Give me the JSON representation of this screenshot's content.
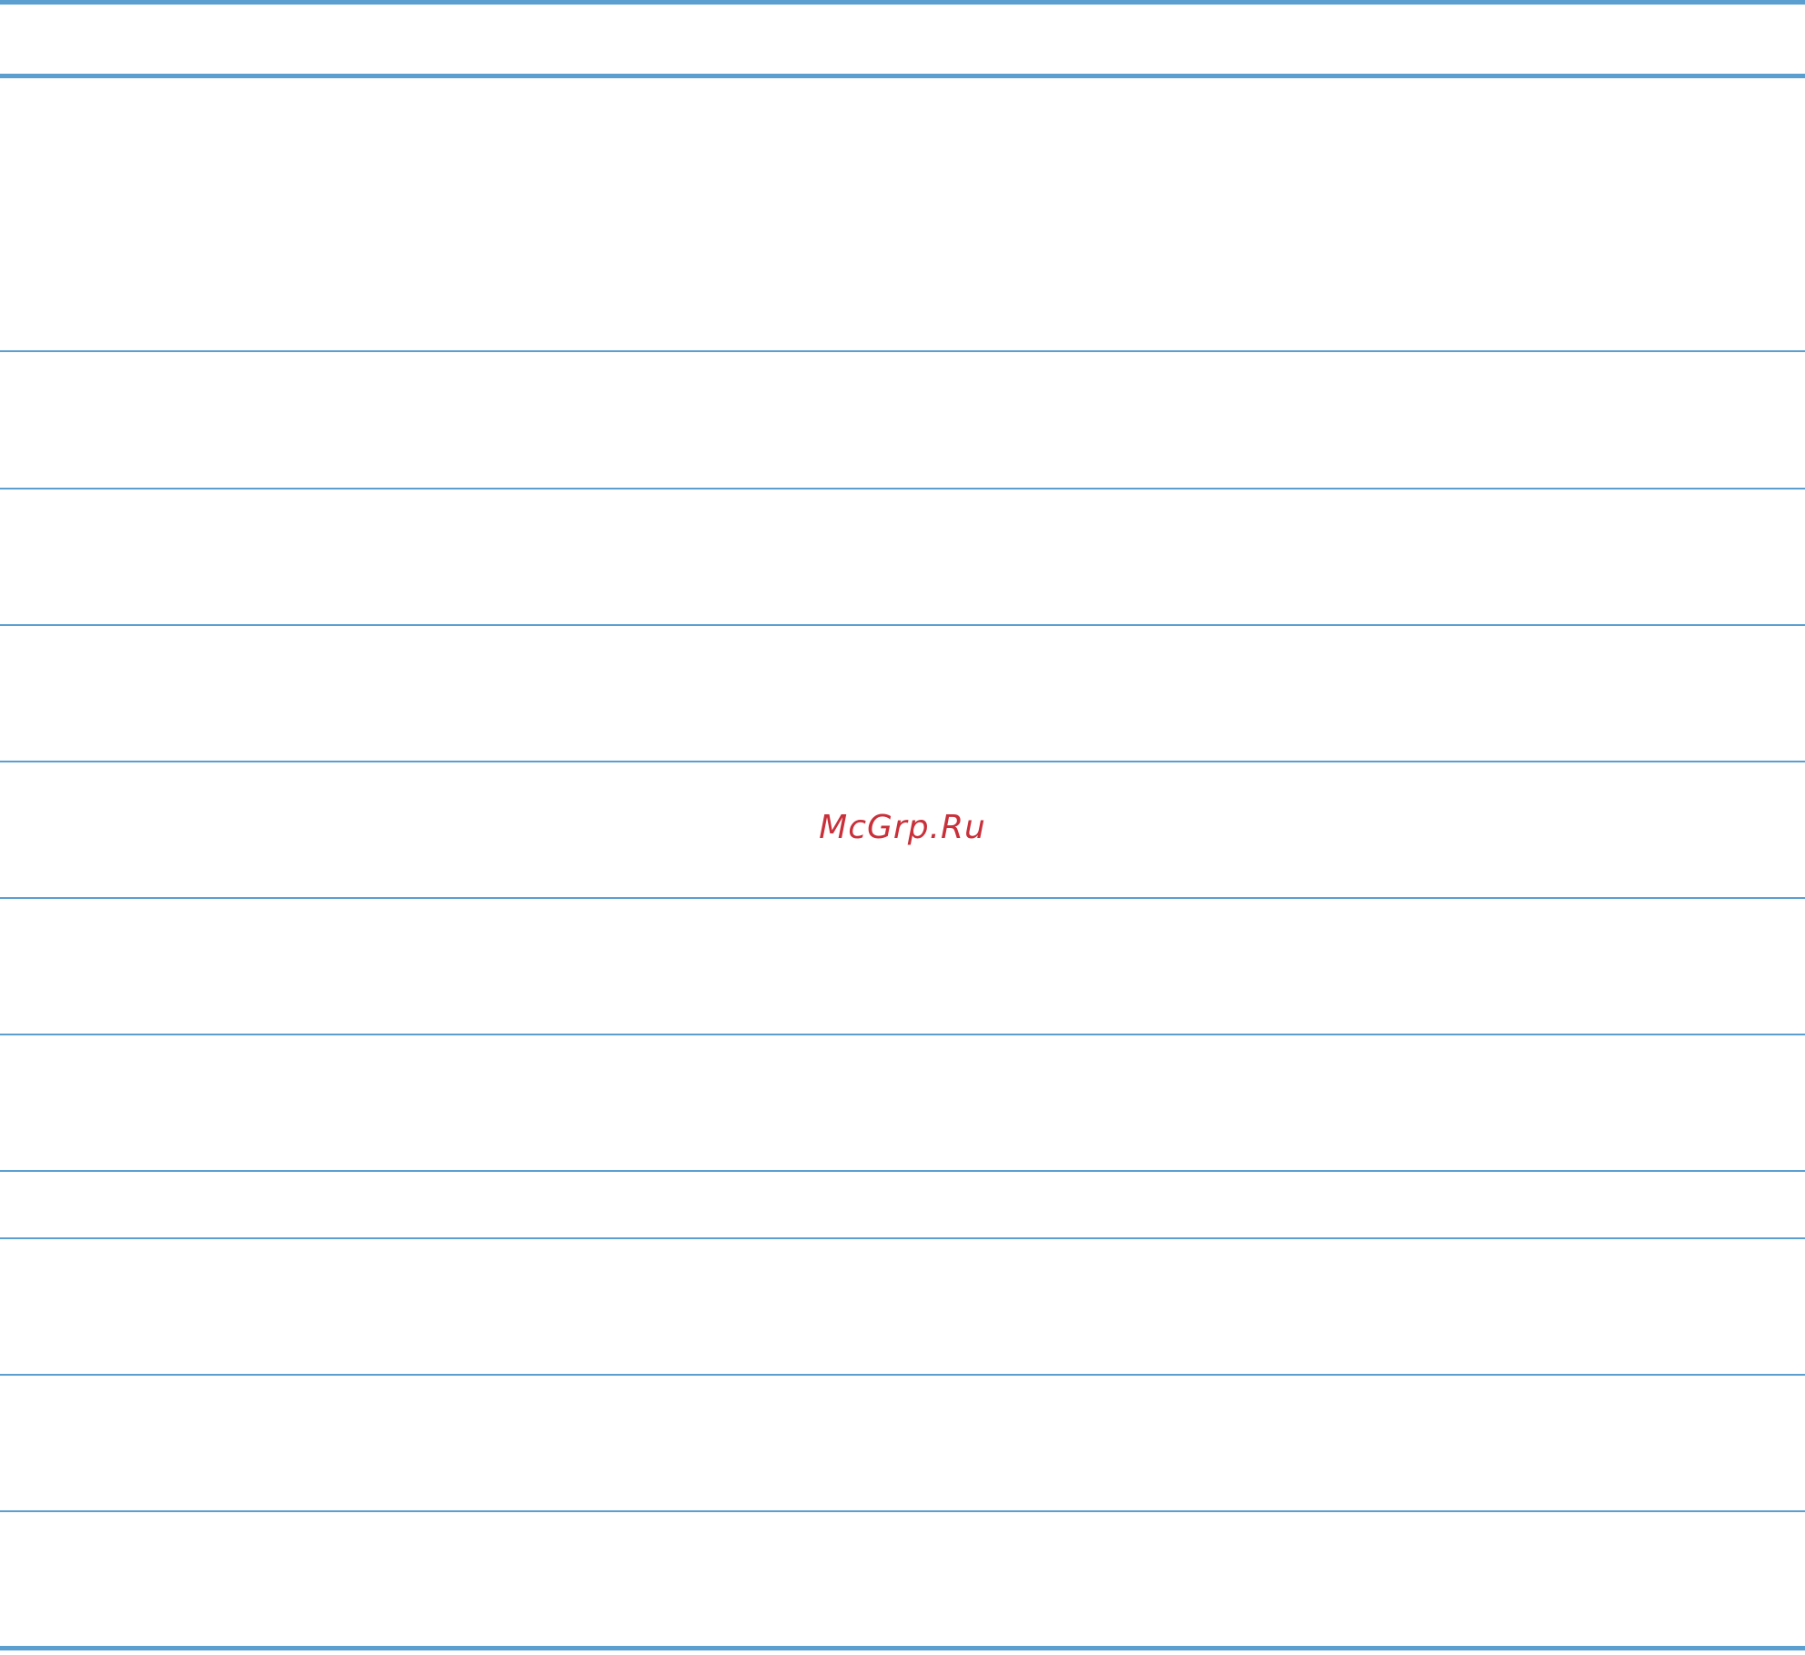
{
  "watermark": {
    "text": "McGrp.Ru",
    "color": "#c9303a"
  },
  "colors": {
    "rule": "#5b9fd0",
    "background": "#ffffff"
  },
  "table": {
    "row_count": 11,
    "rows": [
      {
        "text": ""
      },
      {
        "text": ""
      },
      {
        "text": ""
      },
      {
        "text": ""
      },
      {
        "text": ""
      },
      {
        "text": ""
      },
      {
        "text": ""
      },
      {
        "text": ""
      },
      {
        "text": ""
      },
      {
        "text": ""
      },
      {
        "text": ""
      }
    ]
  }
}
